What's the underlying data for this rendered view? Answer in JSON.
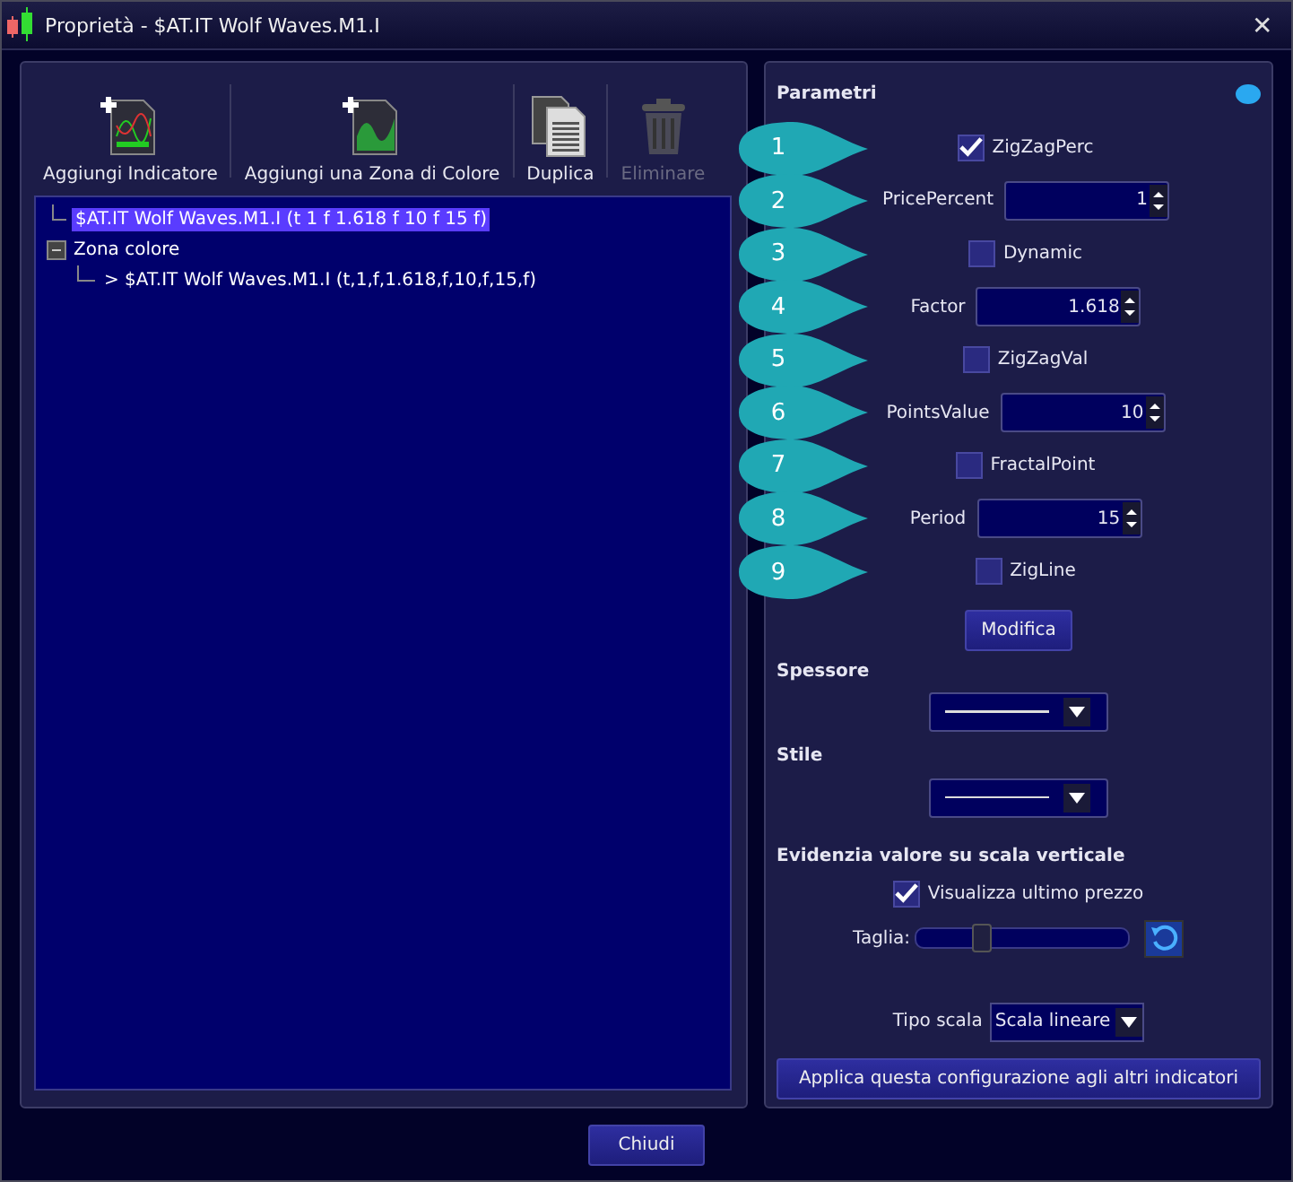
{
  "window": {
    "title": "Proprietà - $AT.IT Wolf Waves.M1.I",
    "close": "✕"
  },
  "toolbar": [
    {
      "kind": "add-indicator",
      "label": "Aggiungi Indicatore",
      "disabled": false
    },
    {
      "kind": "add-zone",
      "label": "Aggiungi una Zona di Colore",
      "disabled": false
    },
    {
      "kind": "duplicate",
      "label": "Duplica",
      "disabled": false
    },
    {
      "kind": "delete",
      "label": "Eliminare",
      "disabled": true
    }
  ],
  "tree": {
    "items": [
      {
        "label": "$AT.IT Wolf Waves.M1.I (t 1 f 1.618 f 10 f 15 f)",
        "selected": true
      },
      {
        "label": "Zona colore",
        "selected": false,
        "expanded": true,
        "children": [
          {
            "label": "> $AT.IT Wolf Waves.M1.I (t,1,f,1.618,f,10,f,15,f)",
            "selected": false
          }
        ]
      }
    ]
  },
  "parameters": {
    "title": "Parametri",
    "rows": [
      {
        "callout": "1",
        "kind": "checkbox",
        "label": "ZigZagPerc",
        "checked": true
      },
      {
        "callout": "2",
        "kind": "spin",
        "label": "PricePercent",
        "value": "1"
      },
      {
        "callout": "3",
        "kind": "checkbox",
        "label": "Dynamic",
        "checked": false
      },
      {
        "callout": "4",
        "kind": "spin",
        "label": "Factor",
        "value": "1.618"
      },
      {
        "callout": "5",
        "kind": "checkbox",
        "label": "ZigZagVal",
        "checked": false
      },
      {
        "callout": "6",
        "kind": "spin",
        "label": "PointsValue",
        "value": "10"
      },
      {
        "callout": "7",
        "kind": "checkbox",
        "label": "FractalPoint",
        "checked": false
      },
      {
        "callout": "8",
        "kind": "spin",
        "label": "Period",
        "value": "15"
      },
      {
        "callout": "9",
        "kind": "checkbox",
        "label": "ZigLine",
        "checked": false
      }
    ],
    "button": "Modifica"
  },
  "thickness": {
    "label": "Spessore"
  },
  "style": {
    "label": "Stile"
  },
  "highlight": {
    "title": "Evidenzia valore su scala verticale",
    "checkbox": {
      "label": "Visualizza ultimo prezzo",
      "checked": true
    },
    "size": {
      "label": "Taglia:",
      "level": 0.3
    }
  },
  "scale": {
    "label": "Tipo scala",
    "value": "Scala lineare"
  },
  "apply": "Applica questa configurazione agli altri indicatori",
  "close_button": "Chiudi"
}
